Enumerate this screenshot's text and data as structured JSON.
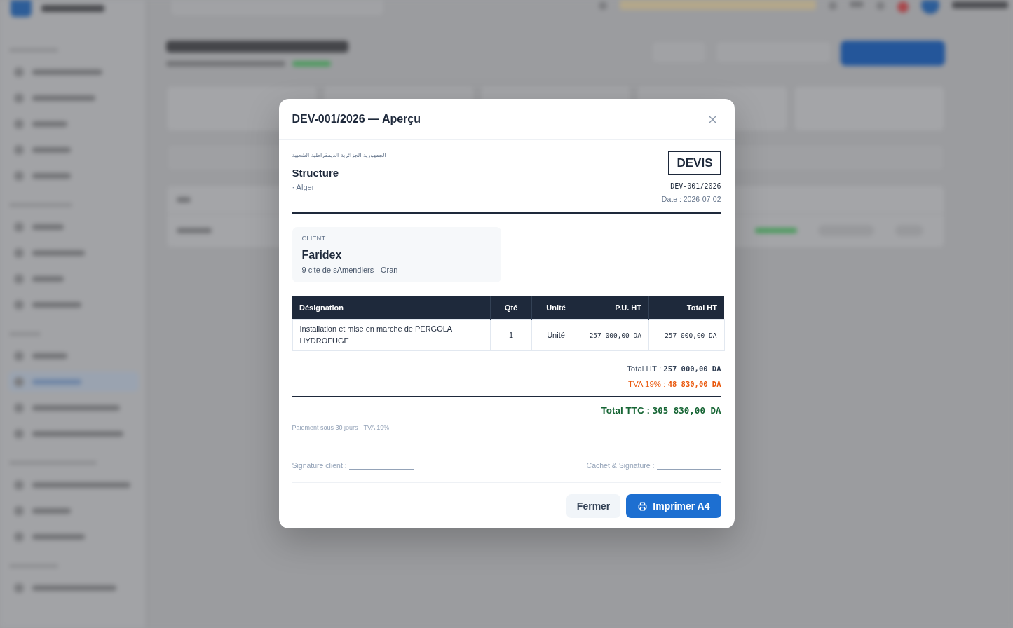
{
  "dialog": {
    "title": "DEV-001/2026 — Aperçu",
    "document": {
      "issuer": {
        "header_line": "الجمهورية الجزائرية الديمقراطية الشعبية",
        "name": "Structure",
        "city": "· Alger"
      },
      "doc_type": "DEVIS",
      "number": "DEV-001/2026",
      "date": "Date : 2026-07-02",
      "client": {
        "label": "CLIENT",
        "name": "Faridex",
        "address": "9 cite de sAmendiers - Oran"
      },
      "table": {
        "columns": [
          "Désignation",
          "Qté",
          "Unité",
          "P.U. HT",
          "Total HT"
        ],
        "rows": [
          {
            "cells": [
              "Installation et mise en marche de PERGOLA HYDROFUGE",
              "1",
              "Unité",
              "257 000,00 DA",
              "257 000,00 DA"
            ]
          }
        ]
      },
      "totals": [
        {
          "kind": "subtotal",
          "label": "Total HT :",
          "value": "257 000,00 DA"
        },
        {
          "kind": "tax",
          "label": "TVA 19% :",
          "value": "48 830,00 DA"
        },
        {
          "kind": "grand_total",
          "label": "Total TTC :",
          "value": "305 830,00 DA"
        }
      ],
      "terms": "Paiement sous 30 jours · TVA 19%",
      "signatures": [
        {
          "label": "Signature client :"
        },
        {
          "label": "Cachet & Signature :"
        }
      ]
    },
    "buttons": [
      {
        "kind": "close",
        "label": "Fermer"
      },
      {
        "kind": "print",
        "label": "Imprimer A4"
      }
    ]
  }
}
